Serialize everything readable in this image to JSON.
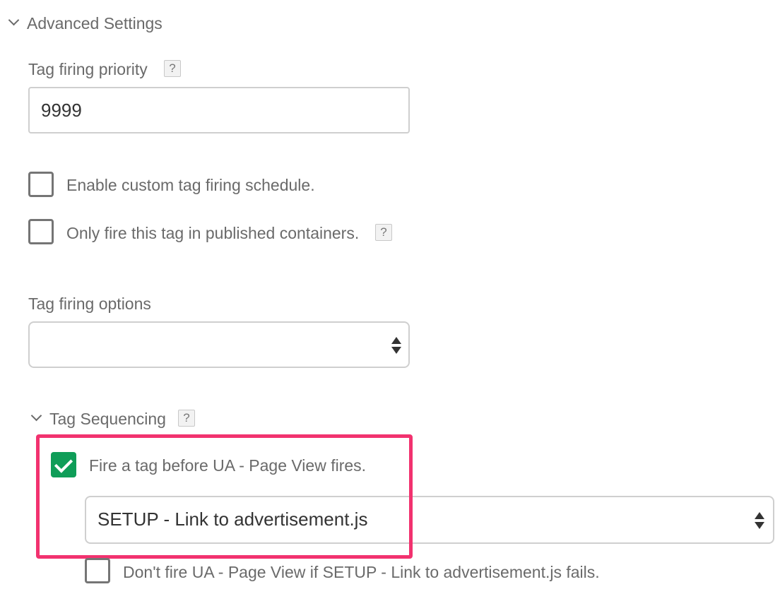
{
  "advanced_settings": {
    "title": "Advanced Settings",
    "expander_icon": "chevron-down-icon"
  },
  "tag_firing_priority": {
    "label": "Tag firing priority",
    "help_icon": "?",
    "value": "9999"
  },
  "checkboxes": {
    "custom_schedule": {
      "label": "Enable custom tag firing schedule.",
      "checked": false
    },
    "published_only": {
      "label": "Only fire this tag in published containers.",
      "checked": false,
      "help_icon": "?"
    }
  },
  "tag_firing_options": {
    "label": "Tag firing options",
    "selected": ""
  },
  "tag_sequencing": {
    "title": "Tag Sequencing",
    "help_icon": "?",
    "fire_before": {
      "label": "Fire a tag before UA - Page View fires.",
      "checked": true
    },
    "setup_tag": {
      "selected": "SETUP - Link to advertisement.js"
    },
    "dont_fire": {
      "label": "Don't fire UA - Page View if SETUP - Link to advertisement.js fails.",
      "checked": false
    }
  },
  "colors": {
    "highlight": "#f2326f",
    "checked": "#0f9d58",
    "text": "#6a6a6a"
  }
}
